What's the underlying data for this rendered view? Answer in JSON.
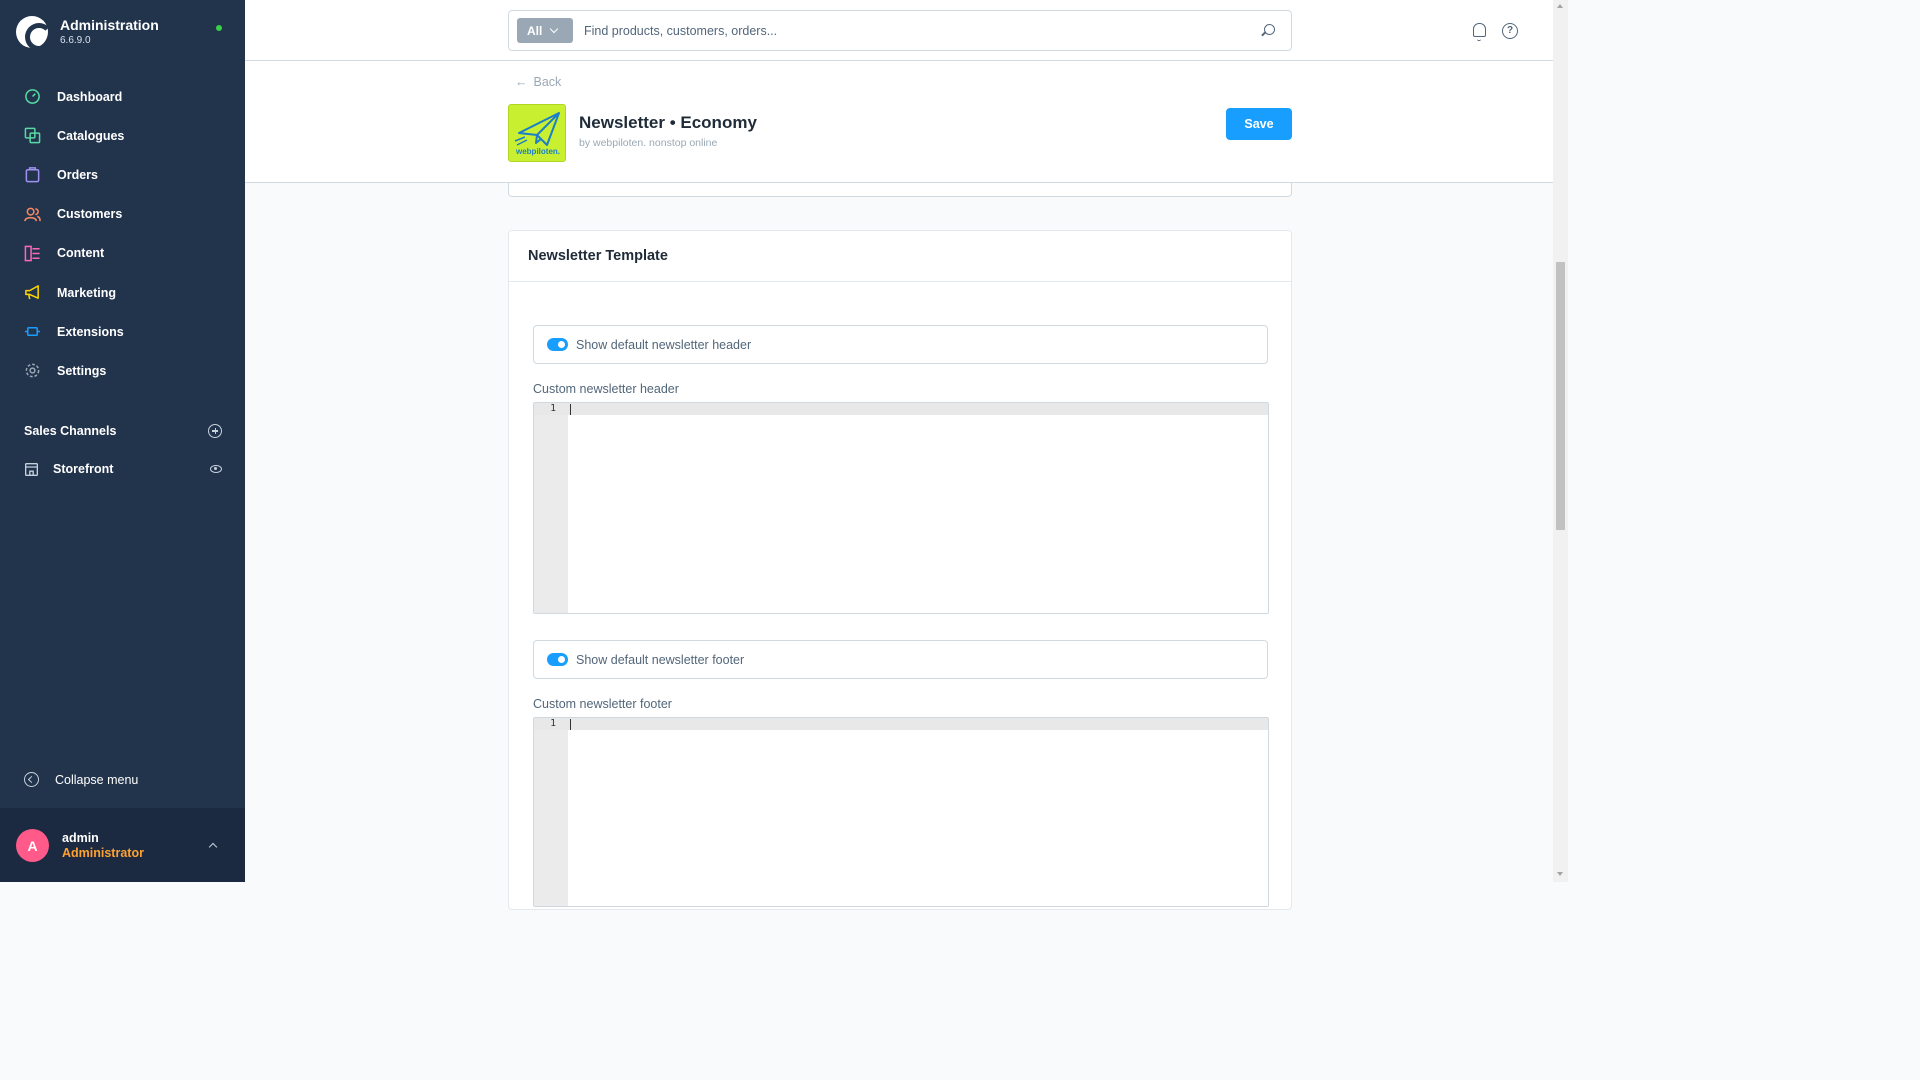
{
  "app": {
    "title": "Administration",
    "version": "6.6.9.0"
  },
  "sidebar": {
    "items": [
      {
        "label": "Dashboard",
        "icon": "dashboard-icon",
        "color": "#57d9a3"
      },
      {
        "label": "Catalogues",
        "icon": "catalogue-icon",
        "color": "#57d9a3"
      },
      {
        "label": "Orders",
        "icon": "orders-icon",
        "color": "#a092f0"
      },
      {
        "label": "Customers",
        "icon": "customers-icon",
        "color": "#f88962"
      },
      {
        "label": "Content",
        "icon": "content-icon",
        "color": "#ff68b4"
      },
      {
        "label": "Marketing",
        "icon": "marketing-icon",
        "color": "#ffd700"
      },
      {
        "label": "Extensions",
        "icon": "extensions-icon",
        "color": "#189eff"
      },
      {
        "label": "Settings",
        "icon": "settings-icon",
        "color": "#9aa8b5"
      }
    ],
    "sales_channels_title": "Sales Channels",
    "storefront_label": "Storefront",
    "collapse_label": "Collapse menu",
    "user": {
      "initial": "A",
      "name": "admin",
      "role": "Administrator"
    }
  },
  "search": {
    "type_label": "All",
    "placeholder": "Find products, customers, orders..."
  },
  "header": {
    "back_label": "Back",
    "plugin_title": "Newsletter • Economy",
    "plugin_author": "by webpiloten. nonstop online",
    "logo_text": "webpiloten.",
    "save_label": "Save"
  },
  "card": {
    "title": "Newsletter Template",
    "header_switch_label": "Show default newsletter header",
    "header_field_label": "Custom newsletter header",
    "footer_switch_label": "Show default newsletter footer",
    "footer_field_label": "Custom newsletter footer",
    "line_number": "1"
  },
  "colors": {
    "sidebar_bg": "#22334c",
    "accent": "#189eff",
    "logo_bg": "#c8f031"
  }
}
